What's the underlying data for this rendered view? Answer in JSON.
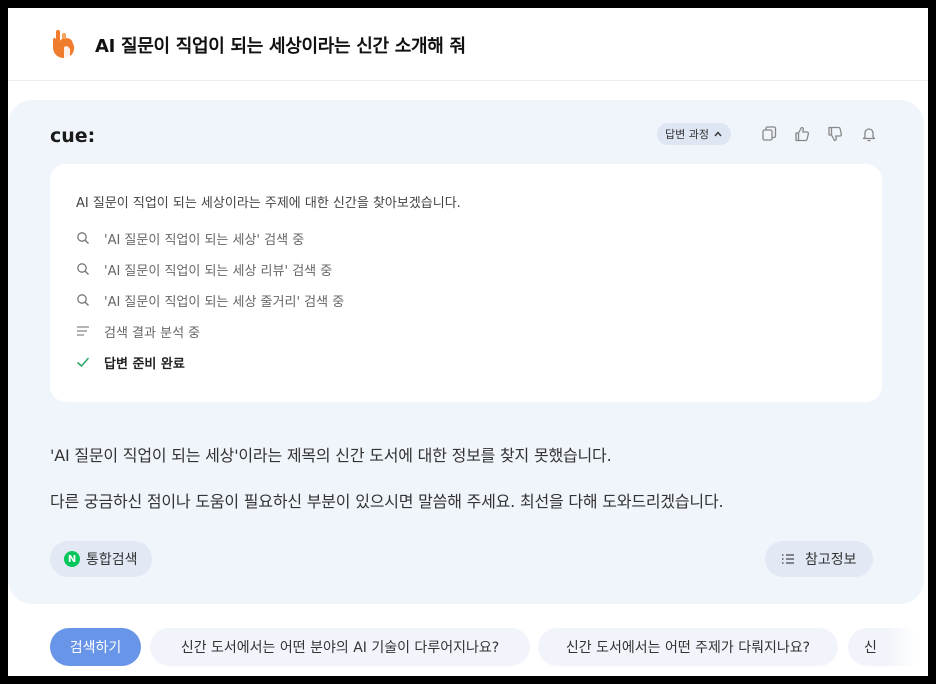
{
  "header": {
    "title": "AI 질문이 직업이 되는 세상이라는 신간 소개해 줘",
    "logo_icon": "hand-logo-icon",
    "logo_color": "#f07d2d"
  },
  "card": {
    "brand": "cue:",
    "process_button_label": "답변 과정",
    "toolbar_icons": [
      "copy-icon",
      "thumbs-up-icon",
      "thumbs-down-icon",
      "bell-icon"
    ],
    "process": {
      "intro": "AI 질문이 직업이 되는 세상이라는 주제에 대한 신간을 찾아보겠습니다.",
      "steps": [
        {
          "icon": "search-icon",
          "text": "'AI 질문이 직업이 되는 세상' 검색 중"
        },
        {
          "icon": "search-icon",
          "text": "'AI 질문이 직업이 되는 세상 리뷰' 검색 중"
        },
        {
          "icon": "search-icon",
          "text": "'AI 질문이 직업이 되는 세상 줄거리' 검색 중"
        },
        {
          "icon": "lines-icon",
          "text": "검색 결과 분석 중"
        },
        {
          "icon": "check-icon",
          "text": "답변 준비 완료"
        }
      ]
    },
    "answer_lines": [
      "'AI 질문이 직업이 되는 세상'이라는 제목의 신간 도서에 대한 정보를 찾지 못했습니다.",
      "다른 궁금하신 점이나 도움이 필요하신 부분이 있으시면 말씀해 주세요. 최선을 다해 도와드리겠습니다."
    ],
    "integrated_search_label": "통합검색",
    "naver_letter": "N",
    "reference_label": "참고정보"
  },
  "suggestions": {
    "search_button": "검색하기",
    "items": [
      "신간 도서에서는 어떤 분야의 AI 기술이 다루어지나요?",
      "신간 도서에서는 어떤 주제가 다뤄지나요?",
      "신"
    ]
  },
  "colors": {
    "accent": "#6895e8",
    "card_bg": "#f0f4fb",
    "check": "#2fa86a",
    "naver_green": "#03c75a"
  }
}
